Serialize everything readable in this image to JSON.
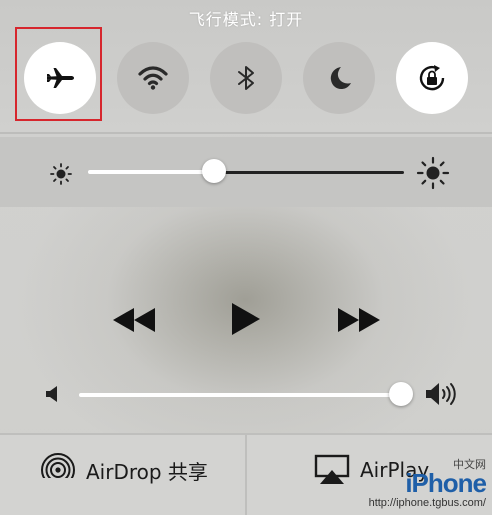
{
  "status": {
    "airplane_mode_message": "飞行模式: 打开"
  },
  "toggles": [
    {
      "name": "airplane-mode",
      "icon": "airplane-icon",
      "state": "on"
    },
    {
      "name": "wifi",
      "icon": "wifi-icon",
      "state": "off"
    },
    {
      "name": "bluetooth",
      "icon": "bluetooth-icon",
      "state": "off"
    },
    {
      "name": "do-not-disturb",
      "icon": "moon-icon",
      "state": "off"
    },
    {
      "name": "rotation-lock",
      "icon": "rotation-lock-icon",
      "state": "on"
    }
  ],
  "brightness": {
    "level": 0.4,
    "min_icon": "sun-small-icon",
    "max_icon": "sun-large-icon"
  },
  "media": {
    "previous_icon": "rewind-icon",
    "play_icon": "play-icon",
    "next_icon": "fast-forward-icon"
  },
  "volume": {
    "level": 1.0,
    "min_icon": "speaker-low-icon",
    "max_icon": "speaker-high-icon"
  },
  "airdrop": {
    "label": "AirDrop 共享",
    "icon": "airdrop-icon"
  },
  "airplay": {
    "label": "AirPlay",
    "icon": "airplay-icon"
  },
  "watermark": {
    "logo": "iPhone",
    "small": "中文网",
    "url": "http://iphone.tgbus.com/"
  },
  "colors": {
    "highlight_box": "#d6262d",
    "toggle_on": "#ffffff",
    "toggle_off": "#c0bfbd"
  }
}
